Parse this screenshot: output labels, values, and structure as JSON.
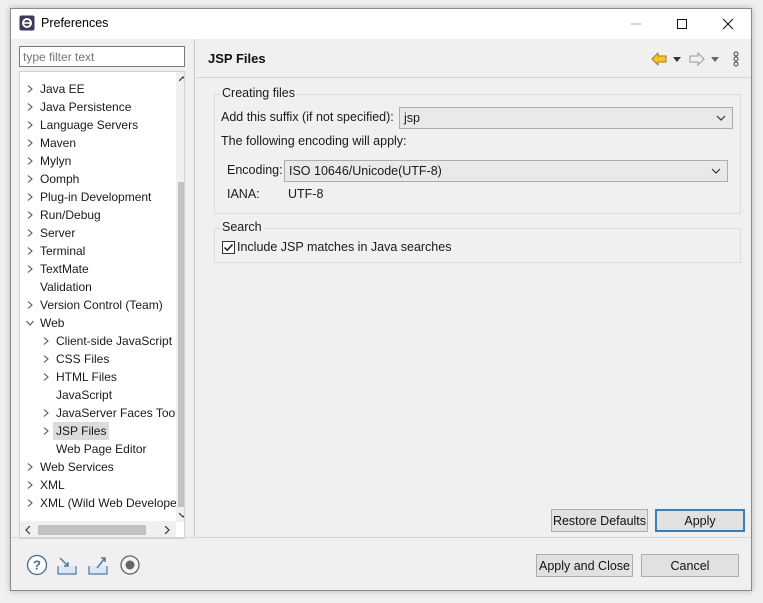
{
  "window": {
    "title": "Preferences"
  },
  "filter": {
    "placeholder": "type filter text"
  },
  "tree": {
    "items": [
      {
        "label": "Java EE",
        "level": 0,
        "expander": "collapsed"
      },
      {
        "label": "Java Persistence",
        "level": 0,
        "expander": "collapsed"
      },
      {
        "label": "Language Servers",
        "level": 0,
        "expander": "collapsed"
      },
      {
        "label": "Maven",
        "level": 0,
        "expander": "collapsed"
      },
      {
        "label": "Mylyn",
        "level": 0,
        "expander": "collapsed"
      },
      {
        "label": "Oomph",
        "level": 0,
        "expander": "collapsed"
      },
      {
        "label": "Plug-in Development",
        "level": 0,
        "expander": "collapsed"
      },
      {
        "label": "Run/Debug",
        "level": 0,
        "expander": "collapsed"
      },
      {
        "label": "Server",
        "level": 0,
        "expander": "collapsed"
      },
      {
        "label": "Terminal",
        "level": 0,
        "expander": "collapsed"
      },
      {
        "label": "TextMate",
        "level": 0,
        "expander": "collapsed"
      },
      {
        "label": "Validation",
        "level": 0,
        "expander": "none"
      },
      {
        "label": "Version Control (Team)",
        "level": 0,
        "expander": "collapsed"
      },
      {
        "label": "Web",
        "level": 0,
        "expander": "expanded"
      },
      {
        "label": "Client-side JavaScript",
        "level": 1,
        "expander": "collapsed"
      },
      {
        "label": "CSS Files",
        "level": 1,
        "expander": "collapsed"
      },
      {
        "label": "HTML Files",
        "level": 1,
        "expander": "collapsed"
      },
      {
        "label": "JavaScript",
        "level": 1,
        "expander": "none"
      },
      {
        "label": "JavaServer Faces Tools",
        "level": 1,
        "expander": "collapsed"
      },
      {
        "label": "JSP Files",
        "level": 1,
        "expander": "collapsed",
        "selected": true
      },
      {
        "label": "Web Page Editor",
        "level": 1,
        "expander": "none"
      },
      {
        "label": "Web Services",
        "level": 0,
        "expander": "collapsed"
      },
      {
        "label": "XML",
        "level": 0,
        "expander": "collapsed"
      },
      {
        "label": "XML (Wild Web Developer)",
        "level": 0,
        "expander": "collapsed"
      }
    ]
  },
  "page": {
    "title": "JSP Files",
    "creating": {
      "title": "Creating files",
      "suffix_label": "Add this suffix (if not specified):",
      "suffix_value": "jsp",
      "encoding_note": "The following encoding will apply:",
      "encoding_label": "Encoding:",
      "encoding_value": "ISO 10646/Unicode(UTF-8)",
      "iana_label": "IANA:",
      "iana_value": "UTF-8"
    },
    "search": {
      "title": "Search",
      "include_label": "Include JSP matches in Java searches",
      "include_checked": true
    },
    "restore_defaults": "Restore Defaults",
    "apply": "Apply"
  },
  "footer": {
    "apply_close": "Apply and Close",
    "cancel": "Cancel",
    "icons": [
      "help-icon",
      "import-icon",
      "export-icon",
      "record-icon"
    ]
  },
  "colors": {
    "accent": "#3c7fb1",
    "selection": "#dcdcdc",
    "nav_back": "#e0a020"
  }
}
